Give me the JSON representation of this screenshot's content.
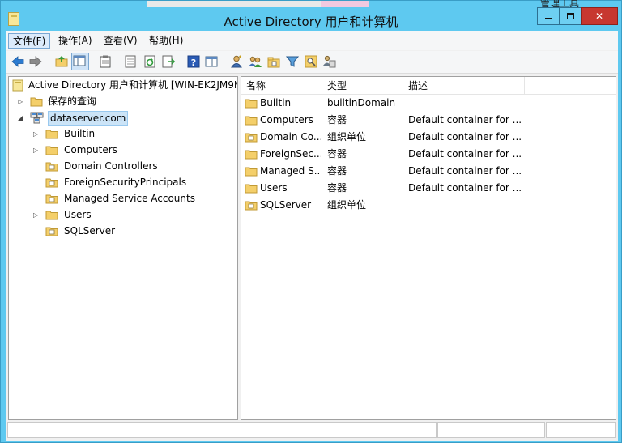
{
  "window": {
    "title": "Active Directory 用户和计算机",
    "behind_text": "管理工具"
  },
  "menu": [
    {
      "label": "文件(F)",
      "active": true
    },
    {
      "label": "操作(A)",
      "active": false
    },
    {
      "label": "查看(V)",
      "active": false
    },
    {
      "label": "帮助(H)",
      "active": false
    }
  ],
  "toolbar": {
    "icons": [
      "back-arrow-icon",
      "forward-arrow-icon",
      "up-folder-icon",
      "console-tree-icon",
      "properties-icon",
      "export-list-icon",
      "refresh-icon",
      "export-icon",
      "help-icon",
      "show-hide-pane-icon",
      "new-user-icon",
      "new-group-icon",
      "new-ou-icon",
      "filter-icon",
      "find-icon",
      "delegate-icon"
    ]
  },
  "tree": {
    "root_label": "Active Directory 用户和计算机 [WIN-EK2JM9N",
    "saved_queries": "保存的查询",
    "domain": "dataserver.com",
    "children": [
      {
        "label": "Builtin",
        "expandable": true
      },
      {
        "label": "Computers",
        "expandable": true
      },
      {
        "label": "Domain Controllers",
        "expandable": false
      },
      {
        "label": "ForeignSecurityPrincipals",
        "expandable": false
      },
      {
        "label": "Managed Service Accounts",
        "expandable": false
      },
      {
        "label": "Users",
        "expandable": true
      },
      {
        "label": "SQLServer",
        "expandable": false
      }
    ]
  },
  "list": {
    "columns": [
      "名称",
      "类型",
      "描述"
    ],
    "rows": [
      {
        "name": "Builtin",
        "type": "builtinDomain",
        "desc": ""
      },
      {
        "name": "Computers",
        "type": "容器",
        "desc": "Default container for ..."
      },
      {
        "name": "Domain Co...",
        "type": "组织单位",
        "desc": "Default container for ..."
      },
      {
        "name": "ForeignSec...",
        "type": "容器",
        "desc": "Default container for ..."
      },
      {
        "name": "Managed S...",
        "type": "容器",
        "desc": "Default container for ..."
      },
      {
        "name": "Users",
        "type": "容器",
        "desc": "Default container for ..."
      },
      {
        "name": "SQLServer",
        "type": "组织单位",
        "desc": ""
      }
    ]
  },
  "colors": {
    "frame": "#5ec9f0",
    "close": "#c7372f",
    "folder": "#f4cf6a",
    "selection": "#cce4f7"
  }
}
